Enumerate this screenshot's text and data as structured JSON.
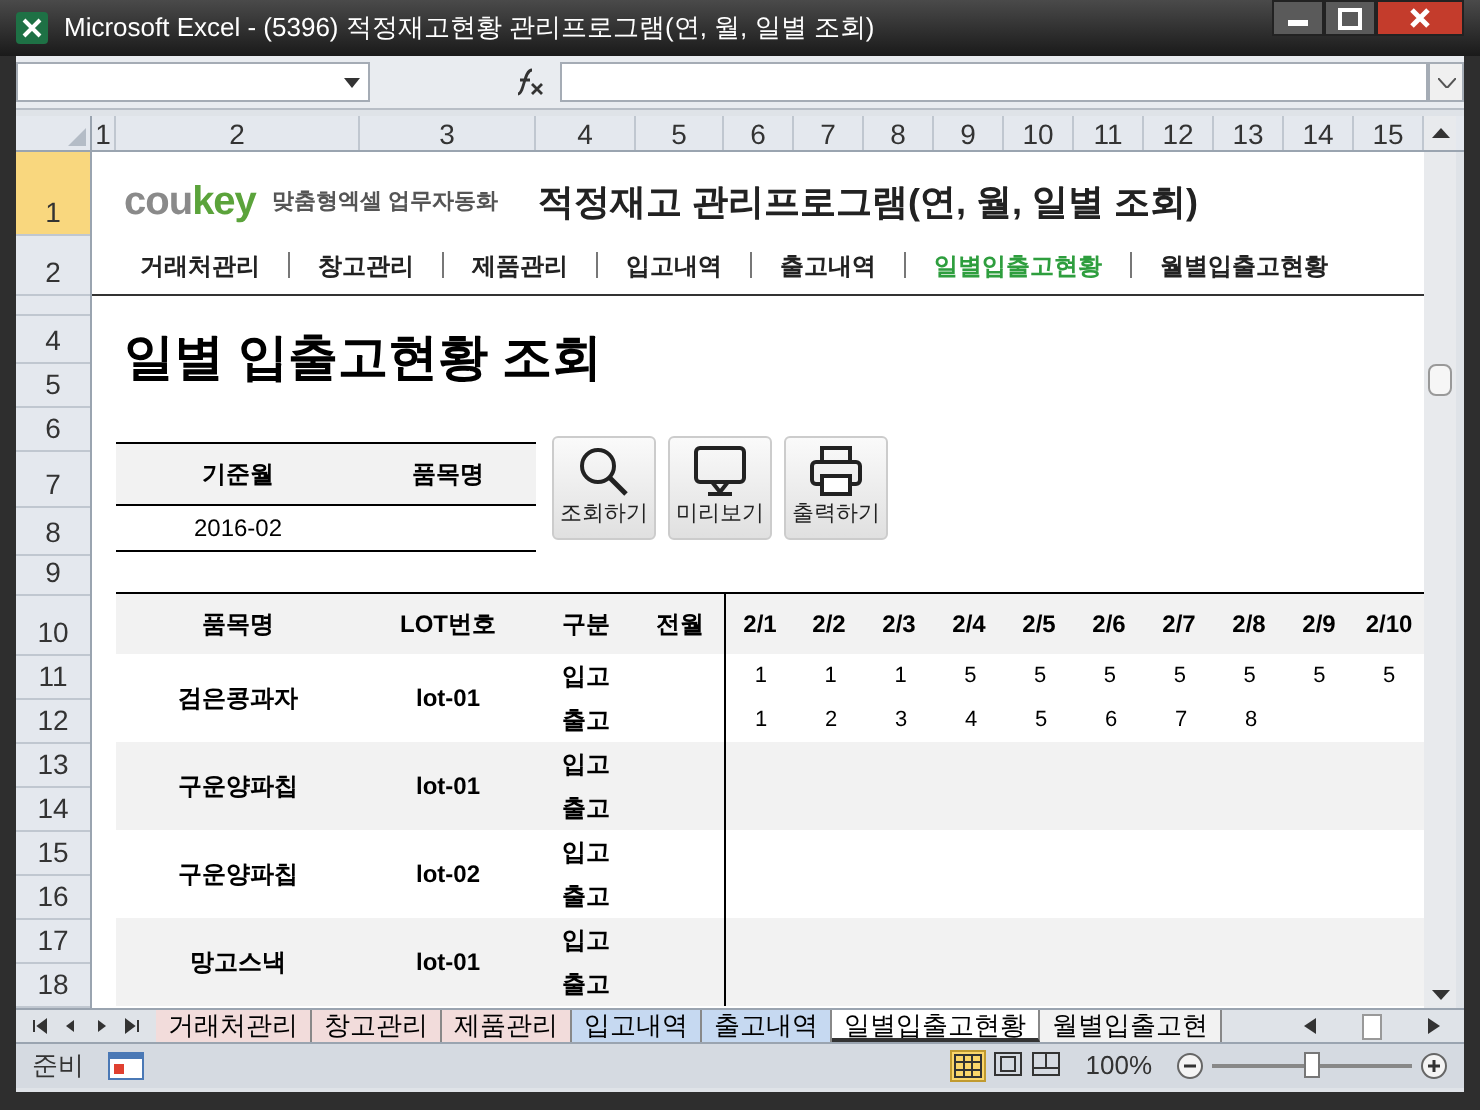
{
  "window": {
    "title": "Microsoft Excel - (5396) 적정재고현황 관리프로그램(연, 월, 일별 조회)"
  },
  "column_headers": [
    "1",
    "2",
    "3",
    "4",
    "5",
    "6",
    "7",
    "8",
    "9",
    "10",
    "11",
    "12",
    "13",
    "14",
    "15"
  ],
  "row_headers": [
    {
      "label": "1",
      "selected": true
    },
    {
      "label": "2",
      "selected": false
    },
    {
      "label": "4",
      "selected": false
    },
    {
      "label": "5",
      "selected": false
    },
    {
      "label": "6",
      "selected": false
    },
    {
      "label": "7",
      "selected": false
    },
    {
      "label": "8",
      "selected": false
    },
    {
      "label": "9",
      "selected": false
    },
    {
      "label": "10",
      "selected": false
    },
    {
      "label": "11",
      "selected": false
    },
    {
      "label": "12",
      "selected": false
    },
    {
      "label": "13",
      "selected": false
    },
    {
      "label": "14",
      "selected": false
    },
    {
      "label": "15",
      "selected": false
    },
    {
      "label": "16",
      "selected": false
    },
    {
      "label": "17",
      "selected": false
    },
    {
      "label": "18",
      "selected": false
    }
  ],
  "header": {
    "logo_part_1": "cou",
    "logo_part_2": "key",
    "tagline": "맞춤형엑셀 업무자동화",
    "title": "적정재고 관리프로그램(연, 월, 일별 조회)"
  },
  "nav": [
    {
      "label": "거래처관리",
      "selected": false
    },
    {
      "label": "창고관리",
      "selected": false
    },
    {
      "label": "제품관리",
      "selected": false
    },
    {
      "label": "입고내역",
      "selected": false
    },
    {
      "label": "출고내역",
      "selected": false
    },
    {
      "label": "일별입출고현황",
      "selected": true
    },
    {
      "label": "월별입출고현황",
      "selected": false
    }
  ],
  "page_heading": "일별 입출고현황 조회",
  "filter": {
    "labels": [
      "기준월",
      "품목명"
    ],
    "month_value": "2016-02"
  },
  "buttons": [
    {
      "label": "조회하기",
      "kind": "search"
    },
    {
      "label": "미리보기",
      "kind": "preview"
    },
    {
      "label": "출력하기",
      "kind": "print"
    }
  ],
  "table": {
    "columns": [
      "품목명",
      "LOT번호",
      "구분",
      "전월",
      "2/1",
      "2/2",
      "2/3",
      "2/4",
      "2/5",
      "2/6",
      "2/7",
      "2/8",
      "2/9",
      "2/10"
    ],
    "rows": [
      {
        "name": "검은콩과자",
        "lot": "lot-01",
        "in_label": "입고",
        "out_label": "출고",
        "in_values": [
          "1",
          "1",
          "1",
          "5",
          "5",
          "5",
          "5",
          "5",
          "5",
          "5"
        ],
        "out_values": [
          "1",
          "2",
          "3",
          "4",
          "5",
          "6",
          "7",
          "8"
        ]
      },
      {
        "name": "구운양파칩",
        "lot": "lot-01",
        "in_label": "입고",
        "out_label": "출고"
      },
      {
        "name": "구운양파칩",
        "lot": "lot-02",
        "in_label": "입고",
        "out_label": "출고"
      },
      {
        "name": "망고스낵",
        "lot": "lot-01",
        "in_label": "입고",
        "out_label": "출고"
      }
    ]
  },
  "sheet_tabs": [
    {
      "label": "거래처관리",
      "color": "#f2dcdb",
      "selected": false
    },
    {
      "label": "창고관리",
      "color": "#f2dcdb",
      "selected": false
    },
    {
      "label": "제품관리",
      "color": "#f2dcdb",
      "selected": false
    },
    {
      "label": "입고내역",
      "color": "#c6d9f1",
      "selected": false
    },
    {
      "label": "출고내역",
      "color": "#c6d9f1",
      "selected": false
    },
    {
      "label": "일별입출고현황",
      "color": "#ffffff",
      "selected": true
    },
    {
      "label": "월별입출고현",
      "color": "#f2f2f2",
      "selected": false
    }
  ],
  "status_bar": {
    "mode": "준비",
    "zoom": "100%",
    "zoom_slider": {
      "level": 0.5
    }
  }
}
